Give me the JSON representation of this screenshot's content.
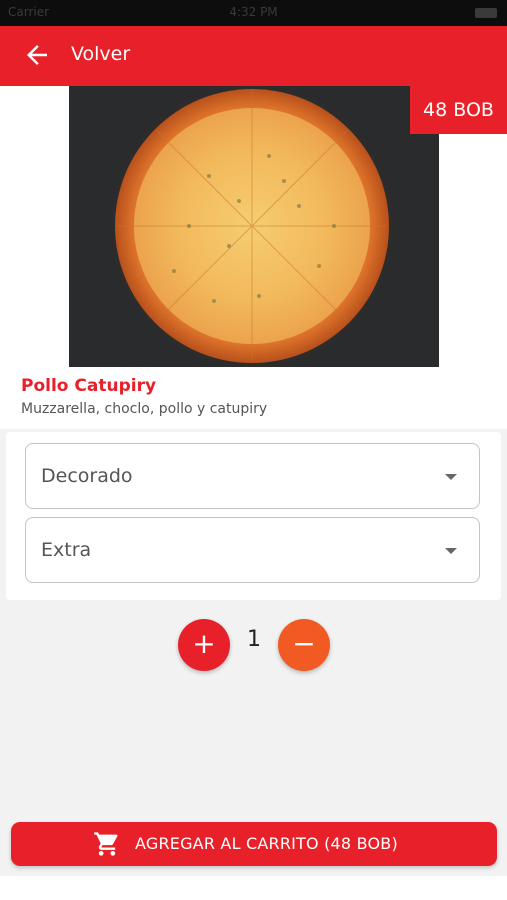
{
  "status_bar": {
    "carrier": "Carrier",
    "time": "4:32 PM"
  },
  "header": {
    "back_label": "Volver",
    "back_icon": "arrow-left-icon"
  },
  "product": {
    "price_tag": "48 BOB",
    "name": "Pollo Catupiry",
    "description": "Muzzarella, choclo, pollo y catupiry"
  },
  "options": [
    {
      "label": "Decorado",
      "icon": "chevron-down-icon"
    },
    {
      "label": "Extra",
      "icon": "chevron-down-icon"
    }
  ],
  "quantity": {
    "value": "1",
    "increase_glyph": "+",
    "decrease_glyph": "−"
  },
  "cart_button": {
    "label": "AGREGAR AL CARRITO (48 BOB)",
    "icon": "shopping-cart-icon"
  },
  "colors": {
    "primary": "#e8202a",
    "secondary": "#f25a24",
    "background": "#f2f2f2"
  }
}
